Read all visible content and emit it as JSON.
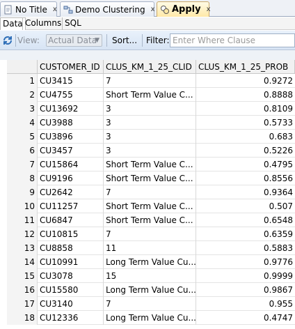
{
  "editor_tabs": [
    {
      "label": "No Title",
      "close": "x"
    },
    {
      "label": "Demo Clustering",
      "close": "x"
    },
    {
      "label": "Apply",
      "close": "x"
    }
  ],
  "sub_tabs": [
    "Data",
    "Columns",
    "SQL"
  ],
  "toolbar": {
    "view_label": "View:",
    "view_value": "Actual Data",
    "sort_label": "Sort...",
    "filter_label": "Filter:",
    "filter_placeholder": "Enter Where Clause"
  },
  "table": {
    "columns": [
      "",
      "CUSTOMER_ID",
      "CLUS_KM_1_25_CLID",
      "CLUS_KM_1_25_PROB"
    ],
    "rows": [
      [
        "1",
        "CU3415",
        "7",
        "0.9272"
      ],
      [
        "2",
        "CU4755",
        "Short Term Value C...",
        "0.8888"
      ],
      [
        "3",
        "CU13692",
        "3",
        "0.8109"
      ],
      [
        "4",
        "CU3988",
        "3",
        "0.5733"
      ],
      [
        "5",
        "CU3896",
        "3",
        "0.683"
      ],
      [
        "6",
        "CU3457",
        "3",
        "0.5226"
      ],
      [
        "7",
        "CU15864",
        "Short Term Value C...",
        "0.4795"
      ],
      [
        "8",
        "CU9196",
        "Short Term Value C...",
        "0.8556"
      ],
      [
        "9",
        "CU2642",
        "7",
        "0.9364"
      ],
      [
        "10",
        "CU11257",
        "Short Term Value C...",
        "0.507"
      ],
      [
        "11",
        "CU6847",
        "Short Term Value C...",
        "0.6548"
      ],
      [
        "12",
        "CU10815",
        "7",
        "0.6359"
      ],
      [
        "13",
        "CU8858",
        "11",
        "0.5883"
      ],
      [
        "14",
        "CU10991",
        "Long Term Value Cu...",
        "0.9776"
      ],
      [
        "15",
        "CU3078",
        "15",
        "0.9999"
      ],
      [
        "16",
        "CU15580",
        "Long Term Value Cu...",
        "0.9867"
      ],
      [
        "17",
        "CU3140",
        "7",
        "0.955"
      ],
      [
        "18",
        "CU12336",
        "Long Term Value Cu...",
        "0.4747"
      ]
    ]
  }
}
